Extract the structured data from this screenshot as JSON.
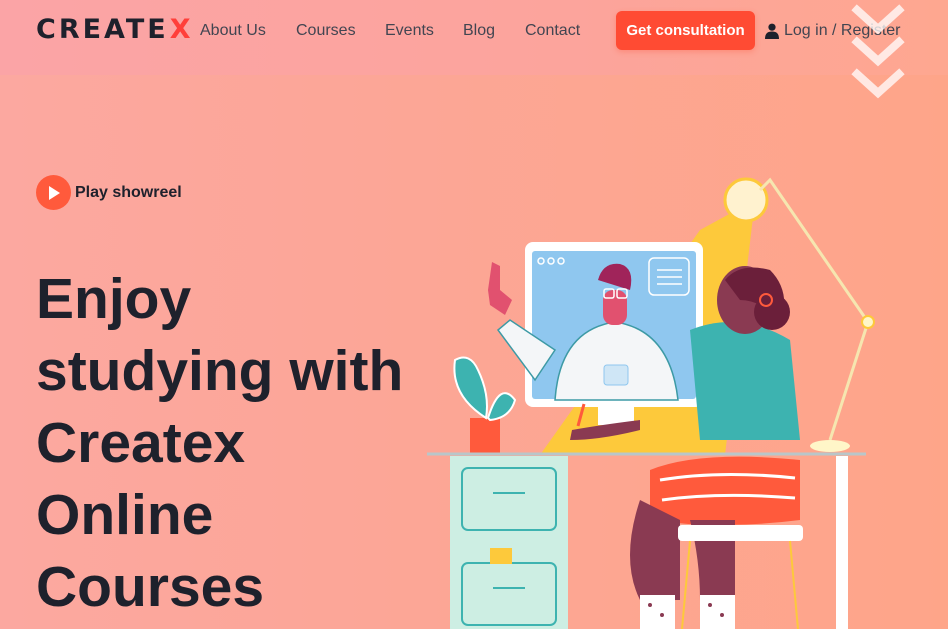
{
  "brand": {
    "name_main": "CREATE",
    "name_accent": "X",
    "accent_color": "#ff3f3a"
  },
  "nav": {
    "items": [
      "About Us",
      "Courses",
      "Events",
      "Blog",
      "Contact"
    ],
    "cta_label": "Get consultation",
    "login_label": "Log in / Register"
  },
  "hero": {
    "showreel_label": "Play showreel",
    "headline_lines": [
      "Enjoy",
      "studying with",
      "Createx",
      "Online",
      "Courses"
    ]
  },
  "icons": {
    "user": "user-icon",
    "play": "play-icon",
    "scroll": "chevron-down-icon"
  },
  "colors": {
    "primary": "#ff4b33",
    "text_dark": "#1e212c",
    "nav_text": "#424551"
  }
}
